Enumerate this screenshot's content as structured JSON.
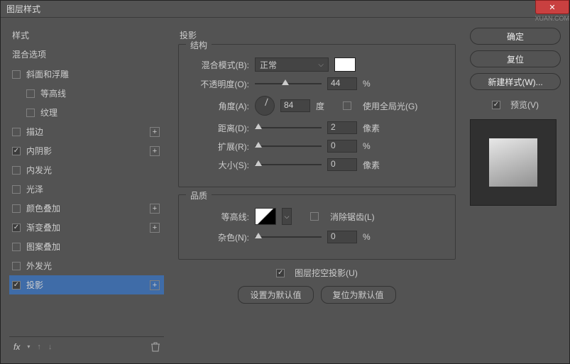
{
  "window": {
    "title": "图层样式"
  },
  "watermark": "XUAN.COM",
  "left": {
    "header": "样式",
    "blend": "混合选项",
    "items": [
      {
        "label": "斜面和浮雕",
        "checked": false,
        "indent": false,
        "plus": false
      },
      {
        "label": "等高线",
        "checked": false,
        "indent": true,
        "plus": false
      },
      {
        "label": "纹理",
        "checked": false,
        "indent": true,
        "plus": false
      },
      {
        "label": "描边",
        "checked": false,
        "indent": false,
        "plus": true
      },
      {
        "label": "内阴影",
        "checked": true,
        "indent": false,
        "plus": true
      },
      {
        "label": "内发光",
        "checked": false,
        "indent": false,
        "plus": false
      },
      {
        "label": "光泽",
        "checked": false,
        "indent": false,
        "plus": false
      },
      {
        "label": "颜色叠加",
        "checked": false,
        "indent": false,
        "plus": true
      },
      {
        "label": "渐变叠加",
        "checked": true,
        "indent": false,
        "plus": true
      },
      {
        "label": "图案叠加",
        "checked": false,
        "indent": false,
        "plus": false
      },
      {
        "label": "外发光",
        "checked": false,
        "indent": false,
        "plus": false
      },
      {
        "label": "投影",
        "checked": true,
        "indent": false,
        "plus": true,
        "selected": true
      }
    ],
    "fx": "fx"
  },
  "center": {
    "title": "投影",
    "structure": {
      "legend": "结构",
      "blend_mode_label": "混合模式(B):",
      "blend_mode_value": "正常",
      "opacity_label": "不透明度(O):",
      "opacity_value": "44",
      "opacity_unit": "%",
      "angle_label": "角度(A):",
      "angle_value": "84",
      "angle_unit": "度",
      "global_light": "使用全局光(G)",
      "distance_label": "距离(D):",
      "distance_value": "2",
      "distance_unit": "像素",
      "spread_label": "扩展(R):",
      "spread_value": "0",
      "spread_unit": "%",
      "size_label": "大小(S):",
      "size_value": "0",
      "size_unit": "像素"
    },
    "quality": {
      "legend": "品质",
      "contour_label": "等高线:",
      "antialias": "消除锯齿(L)",
      "noise_label": "杂色(N):",
      "noise_value": "0",
      "noise_unit": "%"
    },
    "knockout": "图层挖空投影(U)",
    "set_default": "设置为默认值",
    "reset_default": "复位为默认值"
  },
  "right": {
    "ok": "确定",
    "reset": "复位",
    "new_style": "新建样式(W)...",
    "preview": "预览(V)"
  }
}
